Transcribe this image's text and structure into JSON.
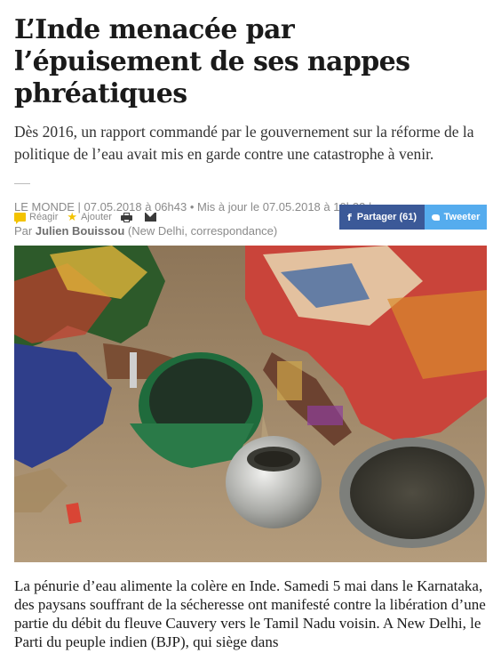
{
  "article": {
    "title": "L’Inde menacée par l’épuisement de ses nappes phréatiques",
    "lede": "Dès 2016, un rapport commandé par le gouvernement sur la réforme de la politique de l’eau avait mis en garde contre une catastrophe à venir.",
    "meta": {
      "source": "Le Monde",
      "published": "07.05.2018 à 06h43",
      "updated": "Mis à jour le 07.05.2018 à 10h33",
      "separator": "|",
      "dot": "•"
    },
    "byline": {
      "prefix": "Par",
      "author": "Julien Bouissou",
      "location": "(New Delhi, correspondance)"
    },
    "body": "La pénurie d’eau alimente la colère en Inde. Samedi 5 mai dans le Karnataka, des paysans souffrant de la sécheresse ont manifesté contre la libération d’une partie du débit du fleuve Cauvery vers le Tamil Nadu voisin. A New Delhi, le Parti du peuple indien (BJP), qui siège dans"
  },
  "toolbar": {
    "react_label": "Réagir",
    "add_label": "Ajouter",
    "icons": [
      "comment-icon",
      "star-icon",
      "print-icon",
      "mail-icon"
    ]
  },
  "share": {
    "facebook_label": "Partager (61)",
    "twitter_label": "Tweeter",
    "facebook_color": "#3b5998",
    "twitter_color": "#55acee"
  },
  "colors": {
    "accent_yellow": "#f3c300",
    "meta_gray": "#8a8a8a"
  }
}
